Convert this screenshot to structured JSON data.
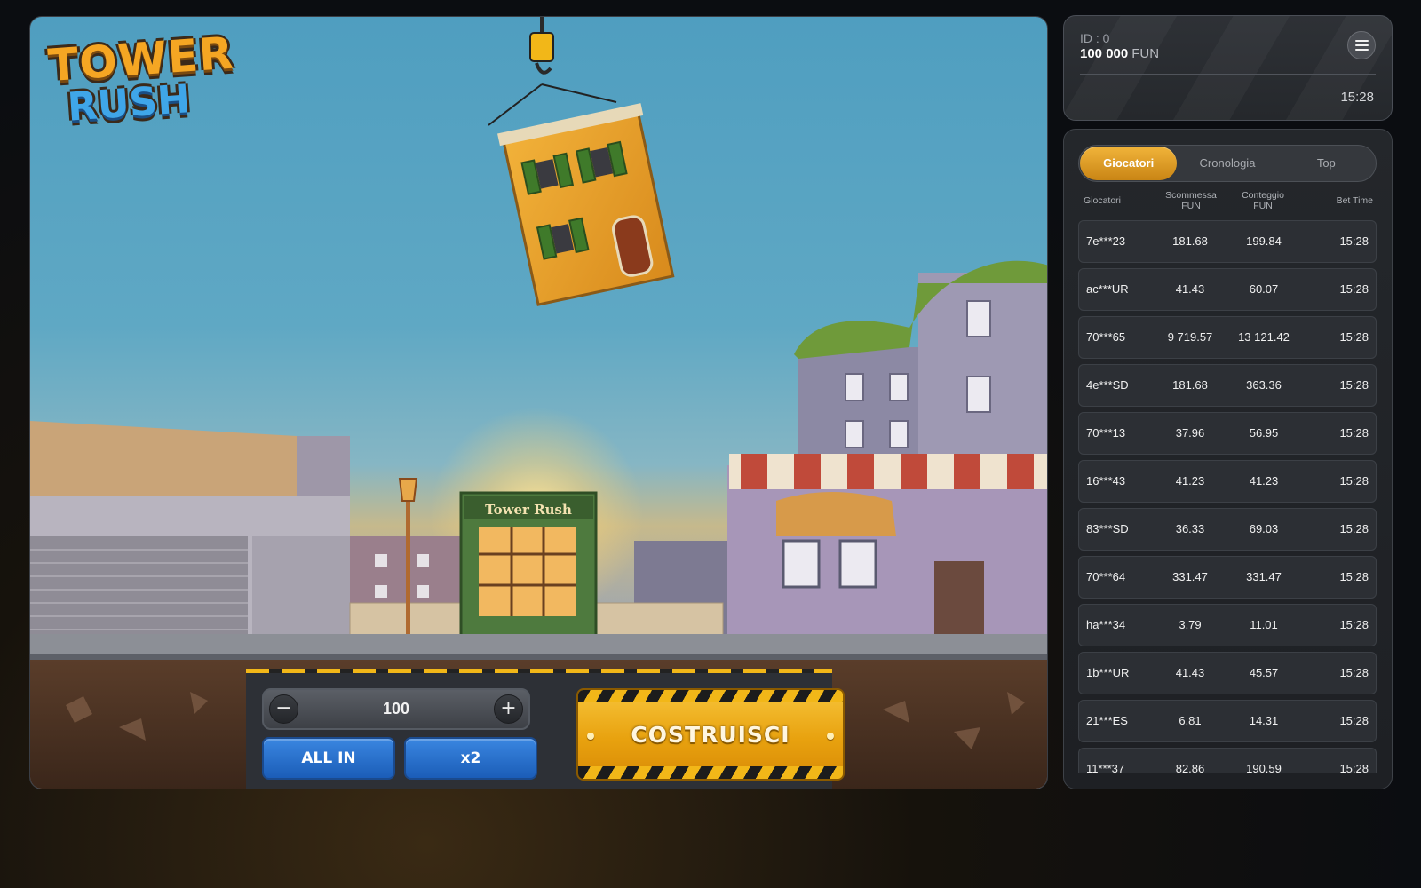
{
  "game": {
    "logo": {
      "line1": "TOWER",
      "line2": "RUSH"
    },
    "shop_sign": "Tower Rush",
    "bet_amount": "100",
    "minus_label": "−",
    "plus_label": "+",
    "all_in_label": "ALL IN",
    "double_label": "x2",
    "build_label": "COSTRUISCI"
  },
  "account": {
    "id_label": "ID : 0",
    "balance_value": "100 000",
    "balance_currency": "FUN",
    "time": "15:28"
  },
  "players_panel": {
    "tabs": [
      {
        "label": "Giocatori",
        "active": true
      },
      {
        "label": "Cronologia",
        "active": false
      },
      {
        "label": "Top",
        "active": false
      }
    ],
    "columns": {
      "player": "Giocatori",
      "bet_line1": "Scommessa",
      "bet_line2": "FUN",
      "count_line1": "Conteggio",
      "count_line2": "FUN",
      "time": "Bet Time"
    },
    "rows": [
      {
        "player": "7e***23",
        "bet": "181.68",
        "count": "199.84",
        "time": "15:28"
      },
      {
        "player": "ac***UR",
        "bet": "41.43",
        "count": "60.07",
        "time": "15:28"
      },
      {
        "player": "70***65",
        "bet": "9 719.57",
        "count": "13 121.42",
        "time": "15:28"
      },
      {
        "player": "4e***SD",
        "bet": "181.68",
        "count": "363.36",
        "time": "15:28"
      },
      {
        "player": "70***13",
        "bet": "37.96",
        "count": "56.95",
        "time": "15:28"
      },
      {
        "player": "16***43",
        "bet": "41.23",
        "count": "41.23",
        "time": "15:28"
      },
      {
        "player": "83***SD",
        "bet": "36.33",
        "count": "69.03",
        "time": "15:28"
      },
      {
        "player": "70***64",
        "bet": "331.47",
        "count": "331.47",
        "time": "15:28"
      },
      {
        "player": "ha***34",
        "bet": "3.79",
        "count": "11.01",
        "time": "15:28"
      },
      {
        "player": "1b***UR",
        "bet": "41.43",
        "count": "45.57",
        "time": "15:28"
      },
      {
        "player": "21***ES",
        "bet": "6.81",
        "count": "14.31",
        "time": "15:28"
      },
      {
        "player": "11***37",
        "bet": "82.86",
        "count": "190.59",
        "time": "15:28"
      }
    ]
  },
  "colors": {
    "accent_gold": "#f1b43a",
    "button_blue": "#1b5db8",
    "panel_bg": "#24272b"
  }
}
